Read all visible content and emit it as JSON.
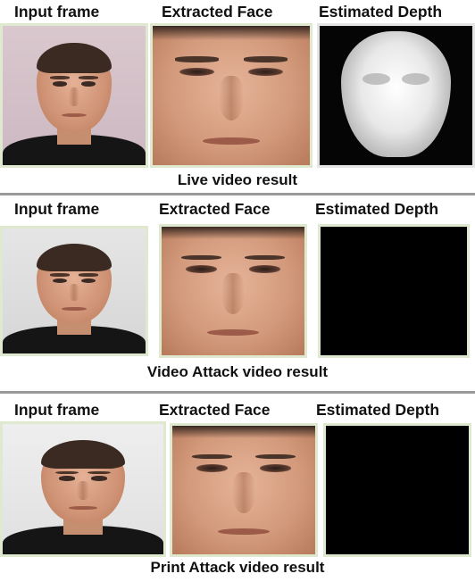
{
  "panels": [
    {
      "headers": {
        "input": "Input frame",
        "face": "Extracted Face",
        "depth": "Estimated Depth"
      },
      "caption": "Live video result"
    },
    {
      "headers": {
        "input": "Input frame",
        "face": "Extracted Face",
        "depth": "Estimated Depth"
      },
      "caption": "Video Attack video result"
    },
    {
      "headers": {
        "input": "Input frame",
        "face": "Extracted Face",
        "depth": "Estimated Depth"
      },
      "caption": "Print Attack video result"
    }
  ]
}
